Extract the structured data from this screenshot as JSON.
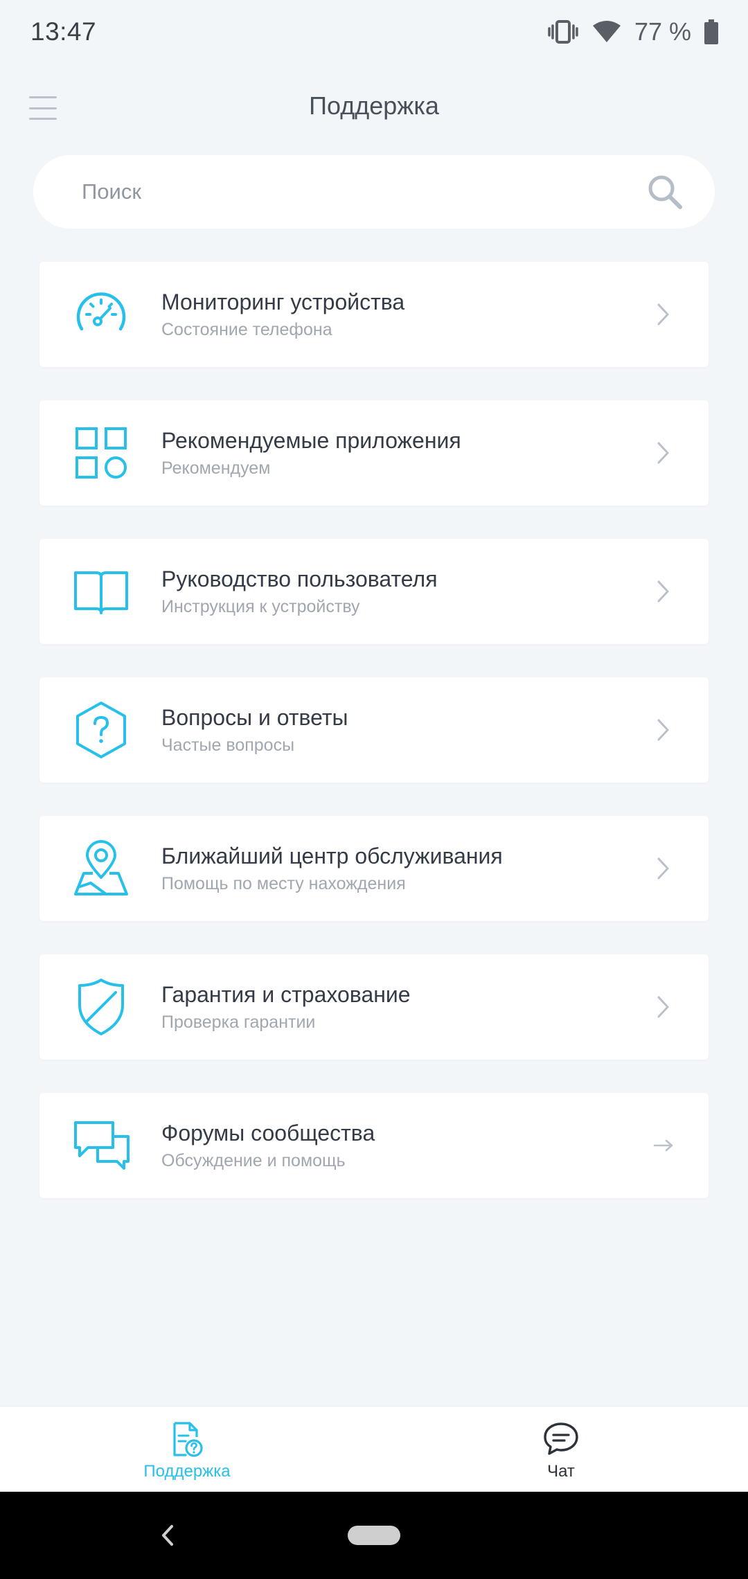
{
  "status": {
    "time": "13:47",
    "battery": "77 %"
  },
  "header": {
    "title": "Поддержка"
  },
  "search": {
    "placeholder": "Поиск"
  },
  "accent_color": "#26c0ea",
  "items": [
    {
      "title": "Мониторинг устройства",
      "subtitle": "Состояние телефона",
      "icon": "speedometer-icon",
      "trailing": "chevron-right-icon"
    },
    {
      "title": "Рекомендуемые приложения",
      "subtitle": "Рекомендуем",
      "icon": "apps-grid-icon",
      "trailing": "chevron-right-icon"
    },
    {
      "title": "Руководство пользователя",
      "subtitle": "Инструкция к устройству",
      "icon": "book-icon",
      "trailing": "chevron-right-icon"
    },
    {
      "title": "Вопросы и ответы",
      "subtitle": "Частые вопросы",
      "icon": "question-hexagon-icon",
      "trailing": "chevron-right-icon"
    },
    {
      "title": "Ближайший центр обслуживания",
      "subtitle": "Помощь по месту нахождения",
      "icon": "map-pin-icon",
      "trailing": "chevron-right-icon"
    },
    {
      "title": "Гарантия и страхование",
      "subtitle": "Проверка гарантии",
      "icon": "shield-icon",
      "trailing": "chevron-right-icon"
    },
    {
      "title": "Форумы сообщества",
      "subtitle": "Обсуждение и помощь",
      "icon": "chat-bubbles-icon",
      "trailing": "arrow-right-icon"
    }
  ],
  "bottom_nav": {
    "support_label": "Поддержка",
    "chat_label": "Чат"
  }
}
